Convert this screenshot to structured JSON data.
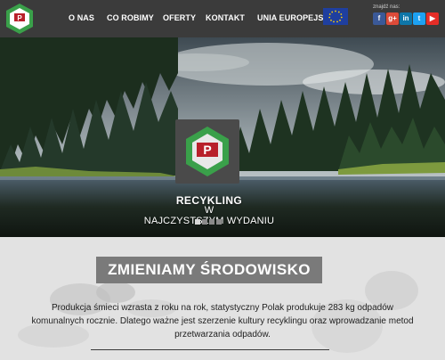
{
  "header": {
    "nav": [
      {
        "label": "O NAS"
      },
      {
        "label": "CO ROBIMY"
      },
      {
        "label": "OFERTY"
      },
      {
        "label": "KONTAKT"
      },
      {
        "label": "UNIA EUROPEJSKA"
      }
    ],
    "find_us_label": "znajdź nas:",
    "social": [
      {
        "icon": "facebook-icon",
        "glyph": "f",
        "color": "#3b5998"
      },
      {
        "icon": "google-plus-icon",
        "glyph": "g+",
        "color": "#dd4b39"
      },
      {
        "icon": "linkedin-icon",
        "glyph": "in",
        "color": "#0e76a8"
      },
      {
        "icon": "twitter-icon",
        "glyph": "t",
        "color": "#1da1f2"
      },
      {
        "icon": "youtube-icon",
        "glyph": "▶",
        "color": "#e52d27"
      }
    ]
  },
  "hero": {
    "line1": "RECYKLING",
    "line2": "W",
    "line3": "NAJCZYSTSZYM WYDANIU",
    "slides": 4,
    "active_slide": 1
  },
  "section": {
    "title": "ZMIENIAMY ŚRODOWISKO",
    "paragraph": "Produkcja śmieci wzrasta z roku na rok, statystyczny Polak produkuje 283 kg odpadów komunalnych rocznie. Dlatego ważne jest szerzenie kultury recyklingu oraz wprowadzanie metod przetwarzania odpadów."
  },
  "colors": {
    "header_bg": "#3b3b3b",
    "recycle_green": "#3aa04a",
    "title_box": "#7a7a7a"
  }
}
